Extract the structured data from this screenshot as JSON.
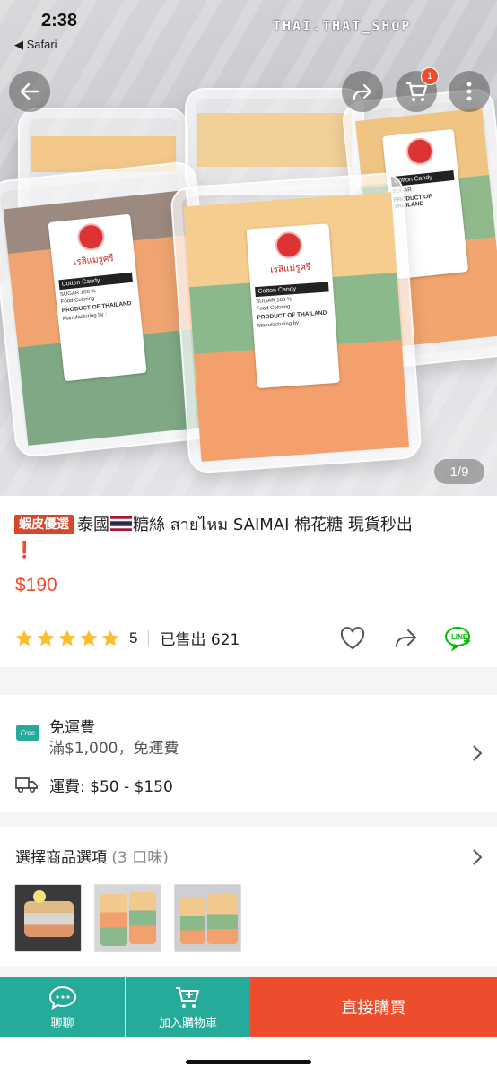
{
  "status": {
    "time": "2:38",
    "back_app": "◀ Safari"
  },
  "hero": {
    "watermark": "THAI.THAT_SHOP",
    "image_counter": "1/9",
    "cart_count": "1",
    "label": {
      "brand": "เรสิแม่รูศรี",
      "product": "Cotton Candy",
      "sugar": "SUGAR",
      "percent": "100 %",
      "coloring": "Food Coloring",
      "origin": "PRODUCT OF THAILAND",
      "mfr": "Manufacturing by :"
    }
  },
  "product": {
    "badge": "蝦皮優選",
    "title_a": "泰國",
    "title_b": "糖絲 สายไหม SAIMAI 棉花糖 現貨秒出",
    "title_c": "❗",
    "price": "$190",
    "rating": "5",
    "sold": "已售出 621"
  },
  "shipping": {
    "free_badge": "Free",
    "title": "免運費",
    "condition": "滿$1,000，免運費",
    "fee": "運費: $50 - $150"
  },
  "variants": {
    "title": "選擇商品選項",
    "count": "(3 口味)"
  },
  "bottom": {
    "chat": "聊聊",
    "add_cart": "加入購物車",
    "buy_now": "直接購買"
  },
  "colors": {
    "accent": "#ee4d2d",
    "teal": "#26aa99",
    "star": "#fbbe2e",
    "line_green": "#00b900"
  }
}
